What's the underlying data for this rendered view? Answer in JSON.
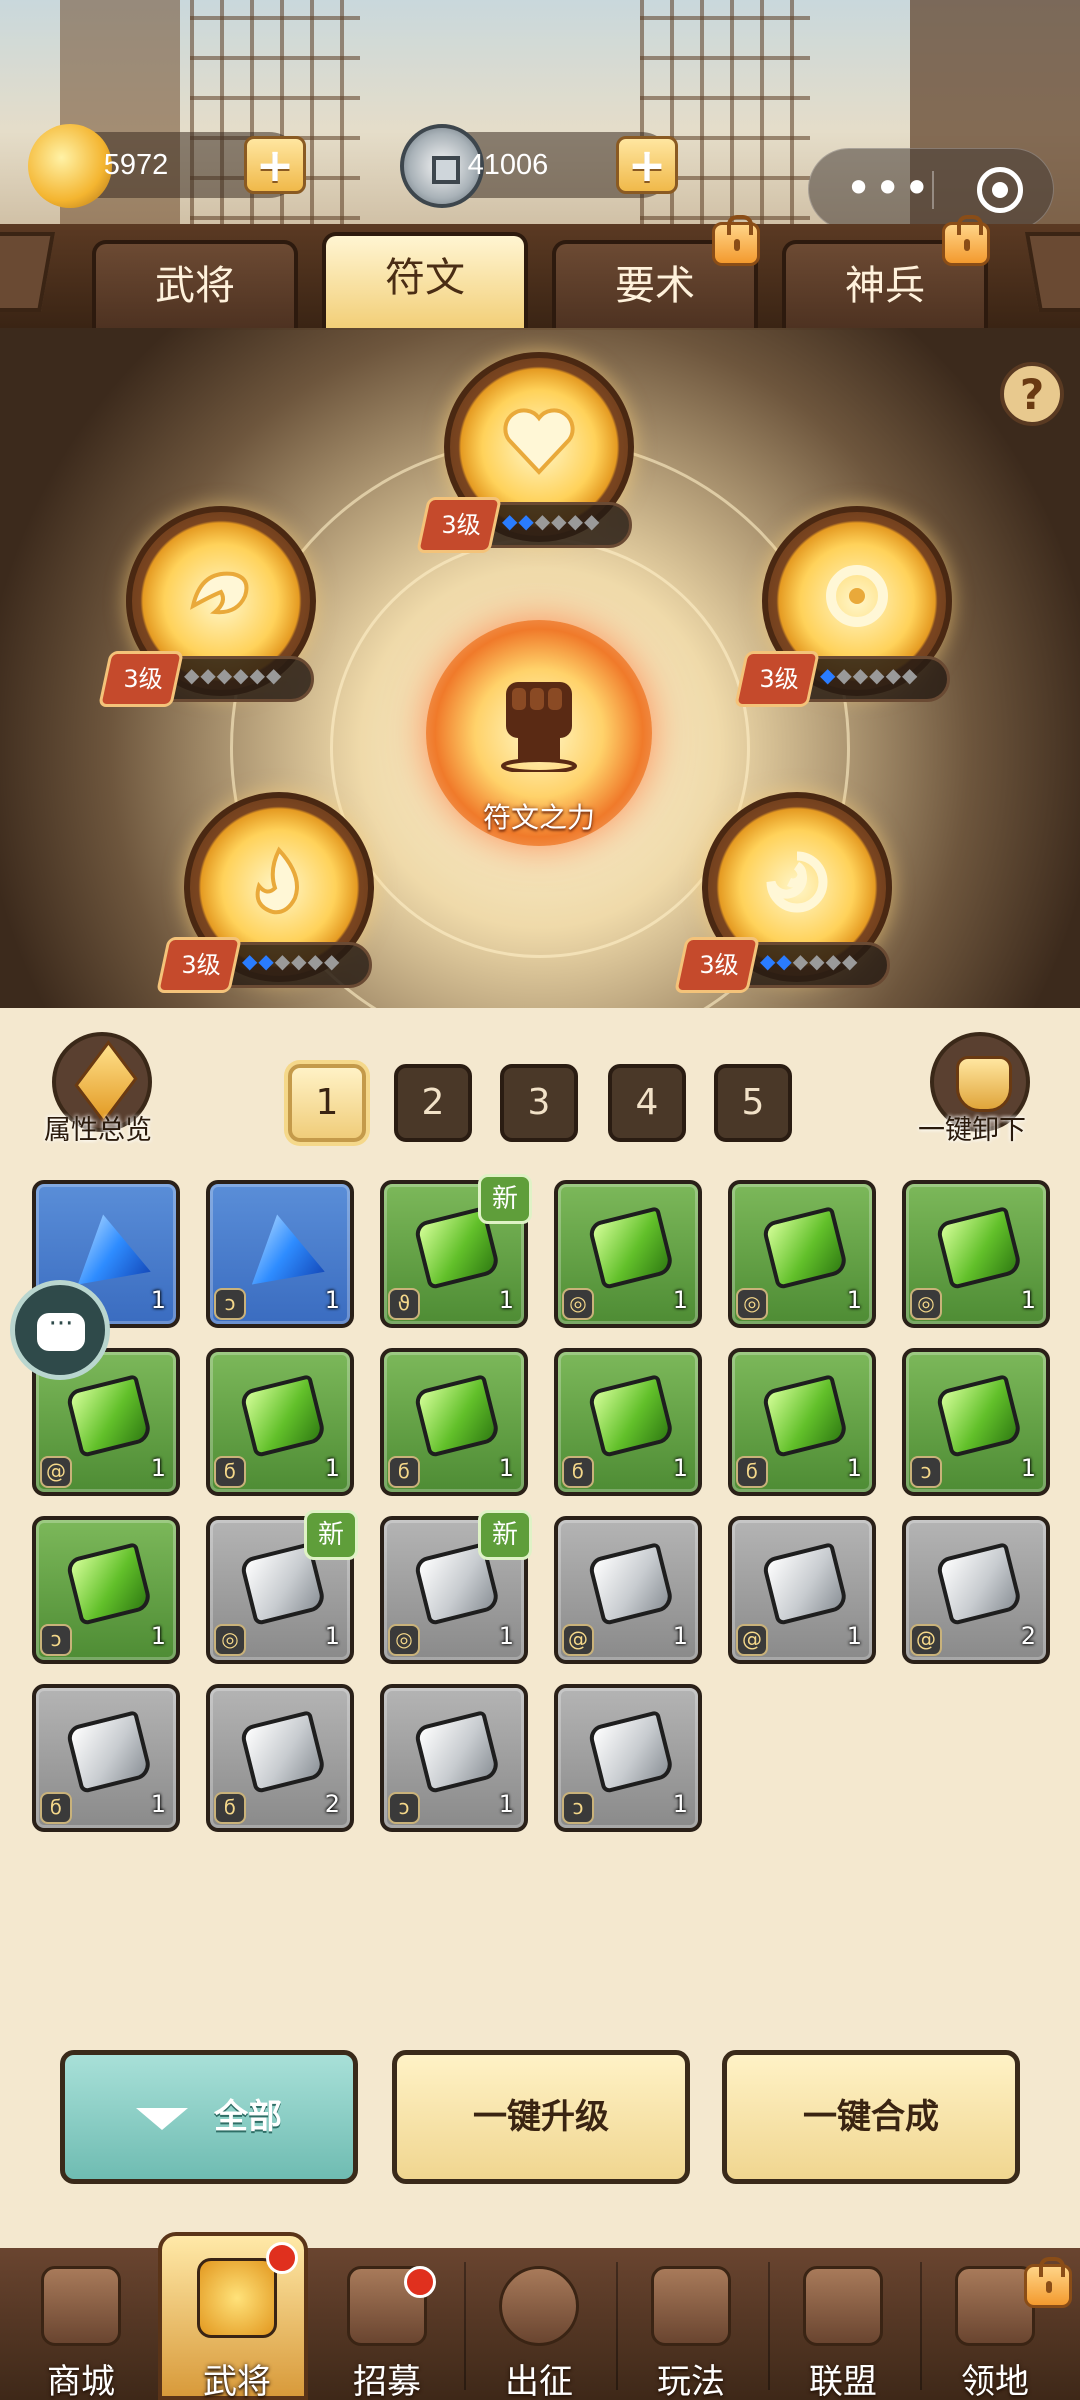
{
  "currency": {
    "gold": "5972",
    "coins": "41006"
  },
  "tabs": [
    {
      "label": "武将",
      "active": false,
      "locked": false
    },
    {
      "label": "符文",
      "active": true,
      "locked": false
    },
    {
      "label": "要术",
      "active": false,
      "locked": true
    },
    {
      "label": "神兵",
      "active": false,
      "locked": true
    }
  ],
  "runes": {
    "slots": [
      {
        "level": "3级",
        "gems_filled": 2,
        "gems_total": 6,
        "glyph": "heart-icon"
      },
      {
        "level": "3级",
        "gems_filled": 0,
        "gems_total": 6,
        "glyph": "dragon-icon"
      },
      {
        "level": "3级",
        "gems_filled": 1,
        "gems_total": 6,
        "glyph": "swirl-icon"
      },
      {
        "level": "3级",
        "gems_filled": 2,
        "gems_total": 6,
        "glyph": "flame-icon"
      },
      {
        "level": "3级",
        "gems_filled": 2,
        "gems_total": 6,
        "glyph": "wind-icon"
      }
    ],
    "center_label": "符文之力"
  },
  "controls": {
    "attr_overview": "属性总览",
    "unload_all": "一键卸下",
    "pages": [
      "1",
      "2",
      "3",
      "4",
      "5"
    ],
    "active_page": "1"
  },
  "inventory": [
    {
      "color": "blue",
      "count": "1",
      "new": false,
      "sym": "◒"
    },
    {
      "color": "blue",
      "count": "1",
      "new": false,
      "sym": "ↄ"
    },
    {
      "color": "green",
      "count": "1",
      "new": true,
      "sym": "ϑ"
    },
    {
      "color": "green",
      "count": "1",
      "new": false,
      "sym": "◎"
    },
    {
      "color": "green",
      "count": "1",
      "new": false,
      "sym": "◎"
    },
    {
      "color": "green",
      "count": "1",
      "new": false,
      "sym": "◎"
    },
    {
      "color": "green",
      "count": "1",
      "new": false,
      "sym": "@"
    },
    {
      "color": "green",
      "count": "1",
      "new": false,
      "sym": "ϭ"
    },
    {
      "color": "green",
      "count": "1",
      "new": false,
      "sym": "ϭ"
    },
    {
      "color": "green",
      "count": "1",
      "new": false,
      "sym": "ϭ"
    },
    {
      "color": "green",
      "count": "1",
      "new": false,
      "sym": "ϭ"
    },
    {
      "color": "green",
      "count": "1",
      "new": false,
      "sym": "ↄ"
    },
    {
      "color": "green",
      "count": "1",
      "new": false,
      "sym": "ↄ"
    },
    {
      "color": "gray",
      "count": "1",
      "new": true,
      "sym": "◎"
    },
    {
      "color": "gray",
      "count": "1",
      "new": true,
      "sym": "◎"
    },
    {
      "color": "gray",
      "count": "1",
      "new": false,
      "sym": "@"
    },
    {
      "color": "gray",
      "count": "1",
      "new": false,
      "sym": "@"
    },
    {
      "color": "gray",
      "count": "2",
      "new": false,
      "sym": "@"
    },
    {
      "color": "gray",
      "count": "1",
      "new": false,
      "sym": "ϭ"
    },
    {
      "color": "gray",
      "count": "2",
      "new": false,
      "sym": "ϭ"
    },
    {
      "color": "gray",
      "count": "1",
      "new": false,
      "sym": "ↄ"
    },
    {
      "color": "gray",
      "count": "1",
      "new": false,
      "sym": "ↄ"
    }
  ],
  "new_label": "新",
  "actions": {
    "filter_all": "全部",
    "upgrade_all": "一键升级",
    "merge_all": "一键合成"
  },
  "nav": [
    {
      "label": "商城",
      "active": false,
      "dot": false,
      "lock": false
    },
    {
      "label": "武将",
      "active": true,
      "dot": true,
      "lock": false
    },
    {
      "label": "招募",
      "active": false,
      "dot": true,
      "lock": false
    },
    {
      "label": "出征",
      "active": false,
      "dot": false,
      "lock": false
    },
    {
      "label": "玩法",
      "active": false,
      "dot": false,
      "lock": false
    },
    {
      "label": "联盟",
      "active": false,
      "dot": false,
      "lock": false
    },
    {
      "label": "领地",
      "active": false,
      "dot": false,
      "lock": true
    }
  ],
  "colors": {
    "accent_gold": "#f0cd7a",
    "gem_blue": "#2a7cff",
    "new_green": "#5f9e3a",
    "notify_red": "#e0301e"
  }
}
